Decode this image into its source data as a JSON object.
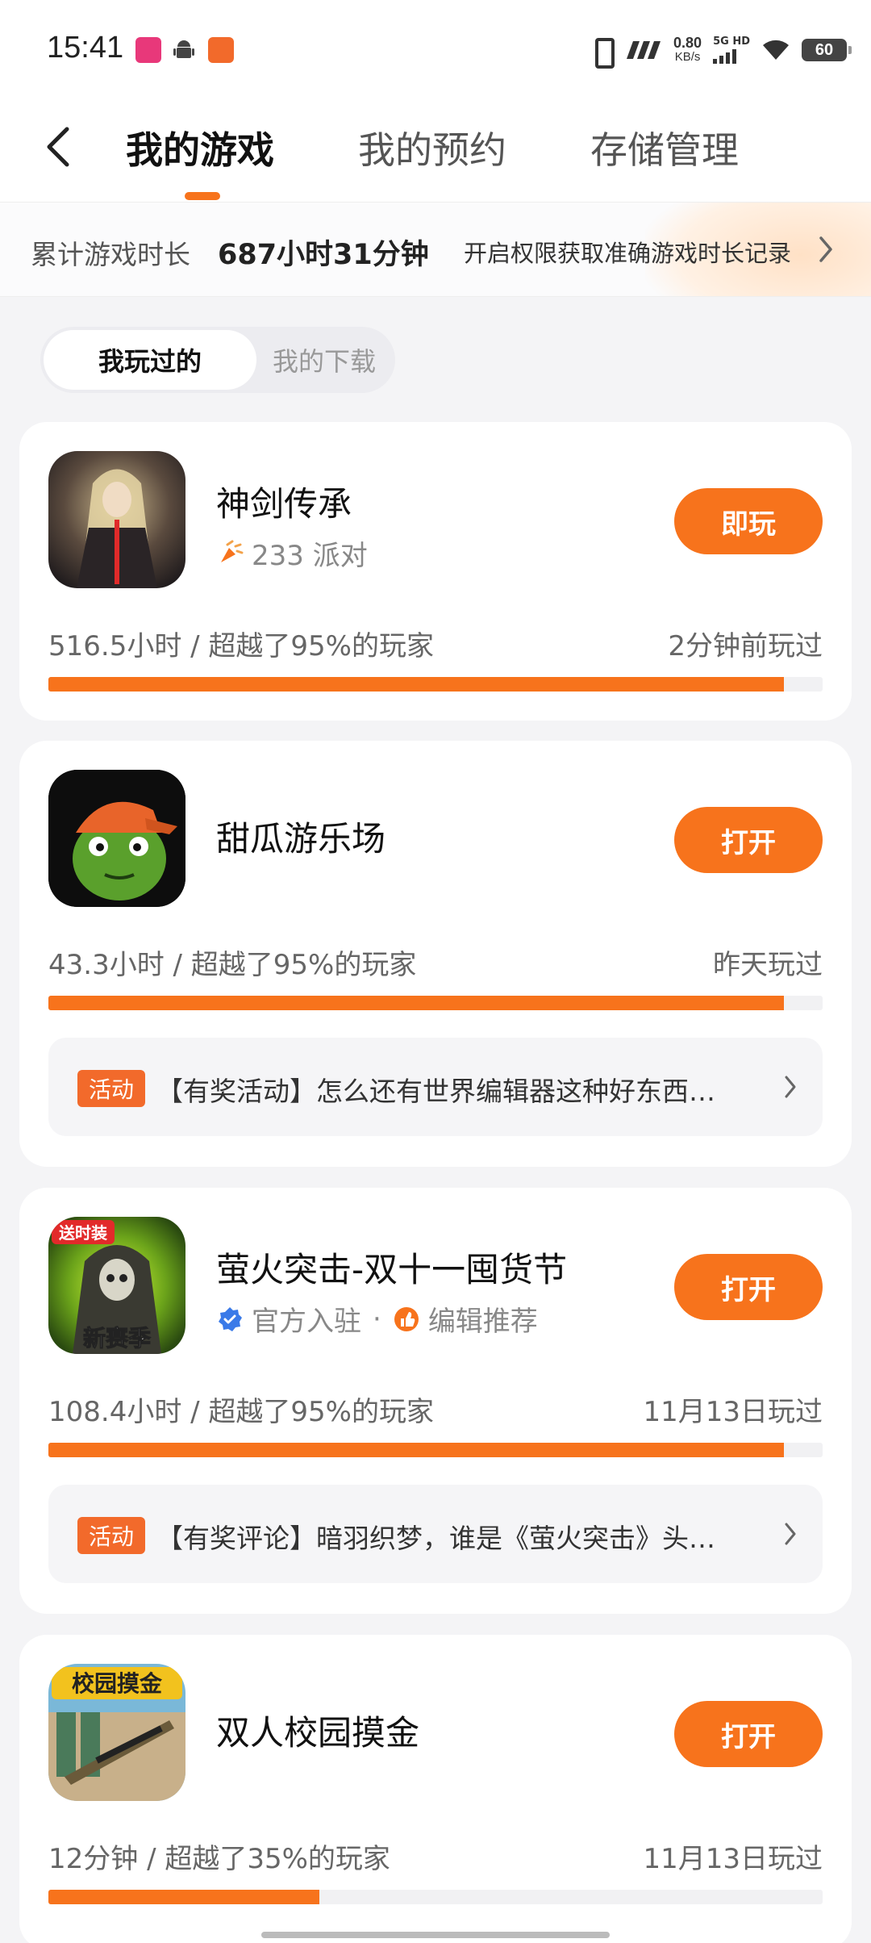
{
  "status_bar": {
    "time": "15:41",
    "net_speed": "0.80",
    "net_unit": "KB/s",
    "signal_label": "5G HD",
    "battery": "60",
    "icons": [
      "bilibili-icon",
      "android-icon",
      "app-icon",
      "vibrate-icon",
      "nfc-icon",
      "signal-icon",
      "wifi-icon",
      "battery-icon"
    ]
  },
  "header": {
    "back_icon": "chevron-left-icon",
    "tabs": [
      {
        "label": "我的游戏",
        "active": true
      },
      {
        "label": "我的预约",
        "active": false
      },
      {
        "label": "存储管理",
        "active": false
      }
    ],
    "accent": "#f7731c"
  },
  "playtime": {
    "label": "累计游戏时长",
    "value": "687小时31分钟",
    "link": "开启权限获取准确游戏时长记录"
  },
  "filter": {
    "items": [
      {
        "label": "我玩过的",
        "active": true
      },
      {
        "label": "我的下载",
        "active": false
      }
    ]
  },
  "games": [
    {
      "name": "神剑传承",
      "sub": "233 派对",
      "button": "即玩",
      "stats": "516.5小时 / 超越了95%的玩家",
      "last_played": "2分钟前玩过",
      "progress": 0.95
    },
    {
      "name": "甜瓜游乐场",
      "button": "打开",
      "stats": "43.3小时 / 超越了95%的玩家",
      "last_played": "昨天玩过",
      "progress": 0.95,
      "activity": {
        "badge": "活动",
        "text": "【有奖活动】怎么还有世界编辑器这种好东西…"
      }
    },
    {
      "name": "萤火突击-双十一囤货节",
      "icon_badges": [
        "送时装",
        "新赛季"
      ],
      "sub_official": "官方入驻",
      "sub_editor": "编辑推荐",
      "sub_dot": "·",
      "button": "打开",
      "stats": "108.4小时 / 超越了95%的玩家",
      "last_played": "11月13日玩过",
      "progress": 0.95,
      "activity": {
        "badge": "活动",
        "text": "【有奖评论】暗羽织梦，谁是《萤火突击》头…"
      }
    },
    {
      "name": "双人校园摸金",
      "icon_badges": [
        "校园摸金"
      ],
      "button": "打开",
      "stats": "12分钟 / 超越了35%的玩家",
      "last_played": "11月13日玩过",
      "progress": 0.35
    }
  ]
}
